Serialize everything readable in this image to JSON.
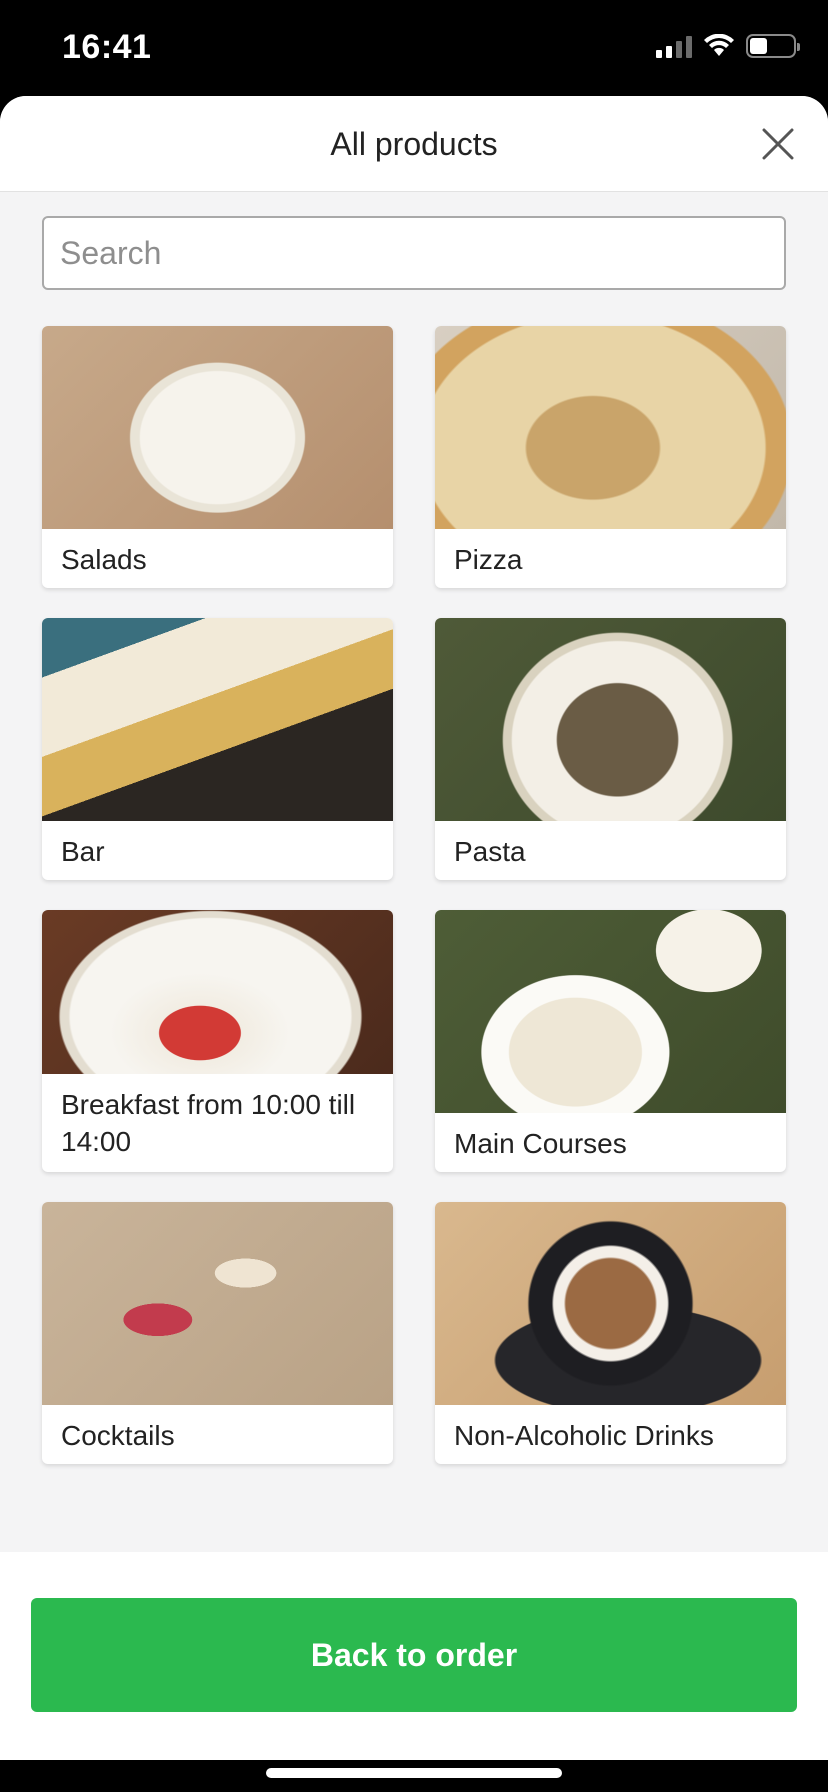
{
  "status_bar": {
    "time": "16:41",
    "battery_level": 0.4
  },
  "header": {
    "title": "All products"
  },
  "search": {
    "placeholder": "Search",
    "value": ""
  },
  "categories": [
    {
      "label": "Salads"
    },
    {
      "label": "Pizza"
    },
    {
      "label": "Bar"
    },
    {
      "label": "Pasta"
    },
    {
      "label": "Breakfast from 10:00 till 14:00"
    },
    {
      "label": "Main Courses"
    },
    {
      "label": "Cocktails"
    },
    {
      "label": "Non-Alcoholic Drinks"
    }
  ],
  "footer": {
    "back_button_label": "Back to order"
  },
  "colors": {
    "accent": "#2bb94f",
    "background": "#f4f4f5"
  }
}
